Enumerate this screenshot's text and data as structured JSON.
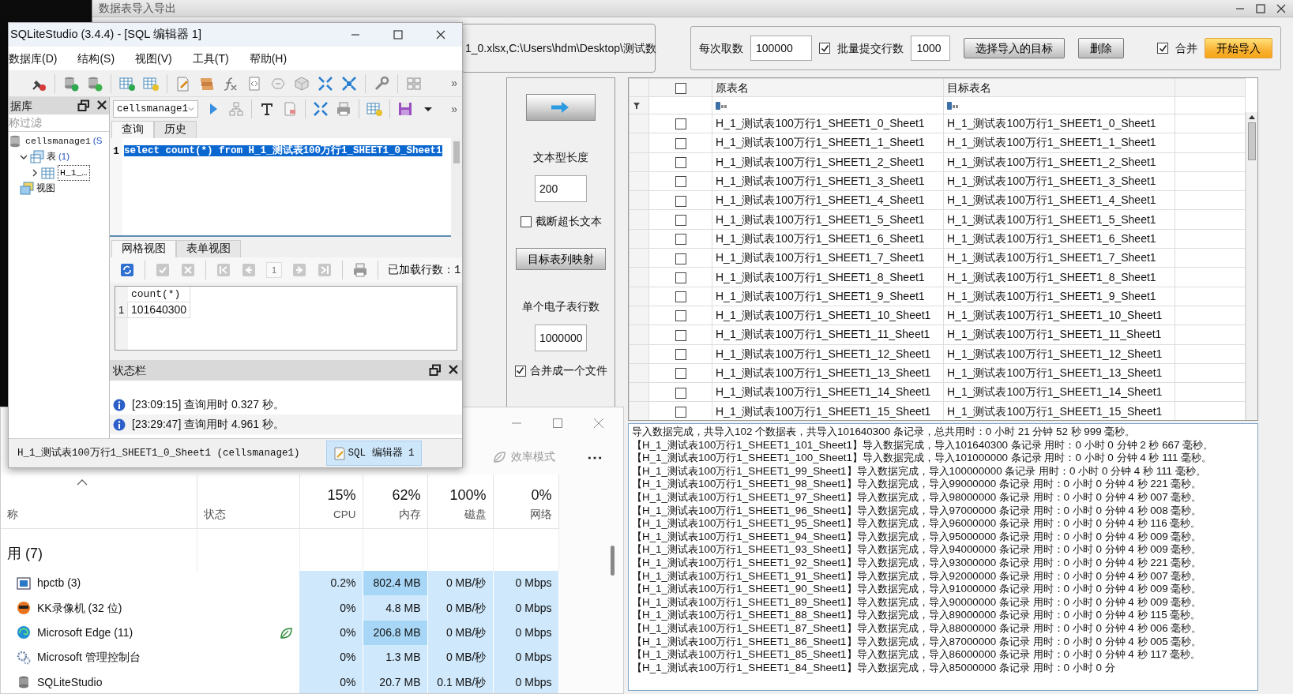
{
  "import_tool": {
    "title": "数据表导入导出",
    "path_value": "1_0.xlsx,C:\\Users\\hdm\\Desktop\\测试数",
    "fetch_label": "每次取数",
    "fetch_value": "100000",
    "batch": {
      "label": "批量提交行数",
      "checked": true
    },
    "batch_value": "1000",
    "buttons": [
      "选择导入的目标",
      "删除"
    ],
    "merge": {
      "label": "合并",
      "checked": true
    },
    "start_button": "开始导入",
    "side_panel": {
      "text_length_label": "文本型长度",
      "text_length_value": "200",
      "truncate": {
        "label": "截断超长文本",
        "checked": false
      },
      "mapping_button": "目标表列映射",
      "rows_label": "单个电子表行数",
      "rows_value": "1000000",
      "merge_file": {
        "label": "合并成一个文件",
        "checked": true
      }
    },
    "grid": {
      "all_checked": false,
      "columns": [
        "原表名",
        "目标表名"
      ],
      "rows": [
        {
          "source": "H_1_测试表100万行1_SHEET1_0_Sheet1",
          "target": "H_1_测试表100万行1_SHEET1_0_Sheet1",
          "checked": false
        },
        {
          "source": "H_1_测试表100万行1_SHEET1_1_Sheet1",
          "target": "H_1_测试表100万行1_SHEET1_1_Sheet1",
          "checked": false
        },
        {
          "source": "H_1_测试表100万行1_SHEET1_2_Sheet1",
          "target": "H_1_测试表100万行1_SHEET1_2_Sheet1",
          "checked": false
        },
        {
          "source": "H_1_测试表100万行1_SHEET1_3_Sheet1",
          "target": "H_1_测试表100万行1_SHEET1_3_Sheet1",
          "checked": false
        },
        {
          "source": "H_1_测试表100万行1_SHEET1_4_Sheet1",
          "target": "H_1_测试表100万行1_SHEET1_4_Sheet1",
          "checked": false
        },
        {
          "source": "H_1_测试表100万行1_SHEET1_5_Sheet1",
          "target": "H_1_测试表100万行1_SHEET1_5_Sheet1",
          "checked": false
        },
        {
          "source": "H_1_测试表100万行1_SHEET1_6_Sheet1",
          "target": "H_1_测试表100万行1_SHEET1_6_Sheet1",
          "checked": false
        },
        {
          "source": "H_1_测试表100万行1_SHEET1_7_Sheet1",
          "target": "H_1_测试表100万行1_SHEET1_7_Sheet1",
          "checked": false
        },
        {
          "source": "H_1_测试表100万行1_SHEET1_8_Sheet1",
          "target": "H_1_测试表100万行1_SHEET1_8_Sheet1",
          "checked": false
        },
        {
          "source": "H_1_测试表100万行1_SHEET1_9_Sheet1",
          "target": "H_1_测试表100万行1_SHEET1_9_Sheet1",
          "checked": false
        },
        {
          "source": "H_1_测试表100万行1_SHEET1_10_Sheet1",
          "target": "H_1_测试表100万行1_SHEET1_10_Sheet1",
          "checked": false
        },
        {
          "source": "H_1_测试表100万行1_SHEET1_11_Sheet1",
          "target": "H_1_测试表100万行1_SHEET1_11_Sheet1",
          "checked": false
        },
        {
          "source": "H_1_测试表100万行1_SHEET1_12_Sheet1",
          "target": "H_1_测试表100万行1_SHEET1_12_Sheet1",
          "checked": false
        },
        {
          "source": "H_1_测试表100万行1_SHEET1_13_Sheet1",
          "target": "H_1_测试表100万行1_SHEET1_13_Sheet1",
          "checked": false
        },
        {
          "source": "H_1_测试表100万行1_SHEET1_14_Sheet1",
          "target": "H_1_测试表100万行1_SHEET1_14_Sheet1",
          "checked": false
        },
        {
          "source": "H_1_测试表100万行1_SHEET1_15_Sheet1",
          "target": "H_1_测试表100万行1_SHEET1_15_Sheet1",
          "checked": false
        }
      ]
    },
    "log": [
      "导入数据完成，共导入102 个数据表，共导入101640300 条记录，总共用时：0 小时 21 分钟 52 秒 999 毫秒。",
      "【H_1_测试表100万行1_SHEET1_101_Sheet1】导入数据完成，导入101640300 条记录 用时：0 小时 0 分钟 2 秒 667 毫秒。",
      "【H_1_测试表100万行1_SHEET1_100_Sheet1】导入数据完成，导入101000000 条记录 用时：0 小时 0 分钟 4 秒 111 毫秒。",
      "【H_1_测试表100万行1_SHEET1_99_Sheet1】导入数据完成，导入100000000 条记录 用时：0 小时 0 分钟 4 秒 111 毫秒。",
      "【H_1_测试表100万行1_SHEET1_98_Sheet1】导入数据完成，导入99000000 条记录 用时：0 小时 0 分钟 4 秒 221 毫秒。",
      "【H_1_测试表100万行1_SHEET1_97_Sheet1】导入数据完成，导入98000000 条记录 用时：0 小时 0 分钟 4 秒 007 毫秒。",
      "【H_1_测试表100万行1_SHEET1_96_Sheet1】导入数据完成，导入97000000 条记录 用时：0 小时 0 分钟 4 秒 008 毫秒。",
      "【H_1_测试表100万行1_SHEET1_95_Sheet1】导入数据完成，导入96000000 条记录 用时：0 小时 0 分钟 4 秒 116 毫秒。",
      "【H_1_测试表100万行1_SHEET1_94_Sheet1】导入数据完成，导入95000000 条记录 用时：0 小时 0 分钟 4 秒 009 毫秒。",
      "【H_1_测试表100万行1_SHEET1_93_Sheet1】导入数据完成，导入94000000 条记录 用时：0 小时 0 分钟 4 秒 009 毫秒。",
      "【H_1_测试表100万行1_SHEET1_92_Sheet1】导入数据完成，导入93000000 条记录 用时：0 小时 0 分钟 4 秒 221 毫秒。",
      "【H_1_测试表100万行1_SHEET1_91_Sheet1】导入数据完成，导入92000000 条记录 用时：0 小时 0 分钟 4 秒 007 毫秒。",
      "【H_1_测试表100万行1_SHEET1_90_Sheet1】导入数据完成，导入91000000 条记录 用时：0 小时 0 分钟 4 秒 009 毫秒。",
      "【H_1_测试表100万行1_SHEET1_89_Sheet1】导入数据完成，导入90000000 条记录 用时：0 小时 0 分钟 4 秒 009 毫秒。",
      "【H_1_测试表100万行1_SHEET1_88_Sheet1】导入数据完成，导入89000000 条记录 用时：0 小时 0 分钟 4 秒 115 毫秒。",
      "【H_1_测试表100万行1_SHEET1_87_Sheet1】导入数据完成，导入88000000 条记录 用时：0 小时 0 分钟 4 秒 006 毫秒。",
      "【H_1_测试表100万行1_SHEET1_86_Sheet1】导入数据完成，导入87000000 条记录 用时：0 小时 0 分钟 4 秒 005 毫秒。",
      "【H_1_测试表100万行1_SHEET1_85_Sheet1】导入数据完成，导入86000000 条记录 用时：0 小时 0 分钟 4 秒 117 毫秒。",
      "【H_1_测试表100万行1_SHEET1_84_Sheet1】导入数据完成，导入85000000 条记录 用时：0 小时 0 分"
    ]
  },
  "task_manager": {
    "toolbar": [
      {
        "label": "效率模式",
        "disabled": true
      }
    ],
    "more": "⋯",
    "columns": [
      {
        "label": "称"
      },
      {
        "label": "状态"
      },
      {
        "percent": "15%",
        "label": "CPU"
      },
      {
        "percent": "62%",
        "label": "内存"
      },
      {
        "percent": "100%",
        "label": "磁盘"
      },
      {
        "percent": "0%",
        "label": "网络"
      }
    ],
    "group": "用 (7)",
    "rows": [
      {
        "name": "hpctb (3)",
        "efficiency": false,
        "cpu": "0.2%",
        "memory": "802.4 MB",
        "memory_high": true,
        "disk": "0 MB/秒",
        "network": "0 Mbps"
      },
      {
        "name": "KK录像机 (32 位)",
        "efficiency": false,
        "cpu": "0%",
        "memory": "4.8 MB",
        "memory_high": false,
        "disk": "0 MB/秒",
        "network": "0 Mbps"
      },
      {
        "name": "Microsoft Edge (11)",
        "efficiency": true,
        "cpu": "0%",
        "memory": "206.8 MB",
        "memory_high": true,
        "disk": "0 MB/秒",
        "network": "0 Mbps"
      },
      {
        "name": "Microsoft 管理控制台",
        "efficiency": false,
        "cpu": "0%",
        "memory": "1.3 MB",
        "memory_high": false,
        "disk": "0 MB/秒",
        "network": "0 Mbps"
      },
      {
        "name": "SQLiteStudio",
        "efficiency": false,
        "cpu": "0%",
        "memory": "20.7 MB",
        "memory_high": false,
        "disk": "0.1 MB/秒",
        "network": "0 Mbps"
      }
    ]
  },
  "sqlitestudio": {
    "title": "SQLiteStudio (3.4.4) - [SQL 编辑器 1]",
    "menu": [
      "数据库(D)",
      "结构(S)",
      "视图(V)",
      "工具(T)",
      "帮助(H)"
    ],
    "toolbar_overflow": "»",
    "db_panel": {
      "title": "据库",
      "filter_placeholder": "称过滤",
      "tree": [
        {
          "label": "cellsmanage1",
          "note": "(S",
          "kind": "database",
          "children": [
            {
              "label": "表",
              "count": "(1)",
              "kind": "tables",
              "expanded": true,
              "children": [
                {
                  "label": "H_1_…",
                  "kind": "table",
                  "expanded": false,
                  "selected": true
                }
              ]
            },
            {
              "label": "视图",
              "kind": "views"
            }
          ]
        }
      ]
    },
    "editor": {
      "database": "cellsmanage1",
      "toolbar_overflow": "»",
      "tabs": [
        {
          "label": "查询",
          "selected": true
        },
        {
          "label": "历史",
          "selected": false
        }
      ],
      "lines": [
        {
          "number": "1",
          "text": "select count(*) from H_1_测试表100万行1_SHEET1_0_Sheet1",
          "selected": true
        }
      ]
    },
    "results": {
      "tabs": [
        {
          "label": "网格视图",
          "selected": true
        },
        {
          "label": "表单视图",
          "selected": false
        }
      ],
      "page": "1",
      "loaded": "已加载行数：1",
      "columns": [
        "count(*)"
      ],
      "rows": [
        {
          "number": "1",
          "cells": [
            "101640300"
          ]
        }
      ]
    },
    "status_panel": {
      "title": "状态栏",
      "messages": [
        "[23:09:15]  查询用时 0.327 秒。",
        "[23:29:47]  查询用时 4.961 秒。"
      ]
    },
    "window_tabs": [
      {
        "label": "H_1_测试表100万行1_SHEET1_0_Sheet1 (cellsmanage1)",
        "selected": false
      },
      {
        "label": "SQL 编辑器 1",
        "selected": true
      }
    ]
  }
}
